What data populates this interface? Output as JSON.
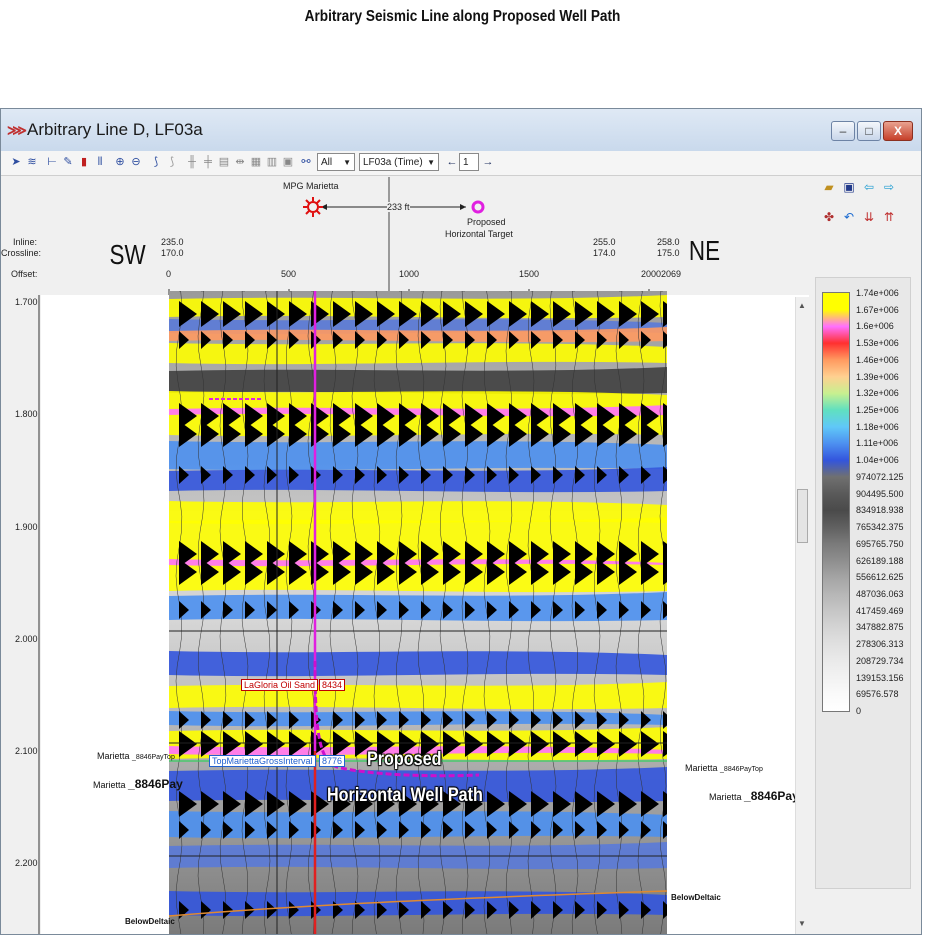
{
  "page_title": "Arbitrary Seismic Line along Proposed Well Path",
  "window": {
    "title": "Arbitrary Line D, LF03a",
    "controls": {
      "minimize": "–",
      "maximize": "□",
      "close": "X"
    }
  },
  "toolbar": {
    "filter_value": "All",
    "volume_value": "LF03a (Time)",
    "line_number": "1"
  },
  "header": {
    "well_label": "MPG Marietta",
    "distance_label": "233 ft",
    "target_label_1": "Proposed",
    "target_label_2": "Horizontal Target",
    "inline_label": "Inline:",
    "crossline_label": "Crossline:",
    "offset_label": "Offset:",
    "left_direction": "SW",
    "right_direction": "NE",
    "left_inline": "235.0",
    "left_crossline": "170.0",
    "right_inline_a": "255.0",
    "right_crossline_a": "174.0",
    "right_inline_b": "258.0",
    "right_crossline_b": "175.0",
    "offsets": [
      "0",
      "500",
      "1000",
      "1500",
      "20002069"
    ]
  },
  "time_axis": [
    "1.700",
    "1.800",
    "1.900",
    "2.000",
    "2.100",
    "2.200"
  ],
  "horizons": {
    "left_top_small": "Marietta",
    "left_top_sub": "_8846PayTop",
    "left_pay": "Marietta",
    "left_pay_sub": "_8846Pay",
    "right_top": "Marietta",
    "right_top_sub": "_8846PayTop",
    "right_pay": "Marietta",
    "right_pay_sub": "_8846Pay",
    "below_left": "BelowDeltaic",
    "below_right": "BelowDeltaic"
  },
  "annotations": {
    "oil_sand": "LaGloria Oil Sand",
    "oil_sand_depth": "8434",
    "gross_interval": "TopMariettaGrossInterval",
    "gross_depth": "8776",
    "well_path_1": "Proposed",
    "well_path_2": "Horizontal Well Path"
  },
  "colorbar": {
    "labels": [
      "1.74e+006",
      "1.67e+006",
      "1.6e+006",
      "1.53e+006",
      "1.46e+006",
      "1.39e+006",
      "1.32e+006",
      "1.25e+006",
      "1.18e+006",
      "1.11e+006",
      "1.04e+006",
      "974072.125",
      "904495.500",
      "834918.938",
      "765342.375",
      "695765.750",
      "626189.188",
      "556612.625",
      "487036.063",
      "417459.469",
      "347882.875",
      "278306.313",
      "208729.734",
      "139153.156",
      "69576.578",
      "0"
    ],
    "colors": [
      "#ffff00",
      "#ffff00",
      "#ff70ff",
      "#ff3030",
      "#ff9a60",
      "#ffd090",
      "#c8f090",
      "#60e0c0",
      "#60c8f8",
      "#4d90f0",
      "#3355dd",
      "#707070",
      "#5a5a5a",
      "#4a4a4a",
      "#606060",
      "#7a7a7a",
      "#8e8e8e",
      "#a4a4a4",
      "#b6b6b6",
      "#c6c6c6",
      "#d4d4d4",
      "#e0e0e0",
      "#eaeaea",
      "#f2f2f2",
      "#fafafa",
      "#ffffff"
    ]
  }
}
